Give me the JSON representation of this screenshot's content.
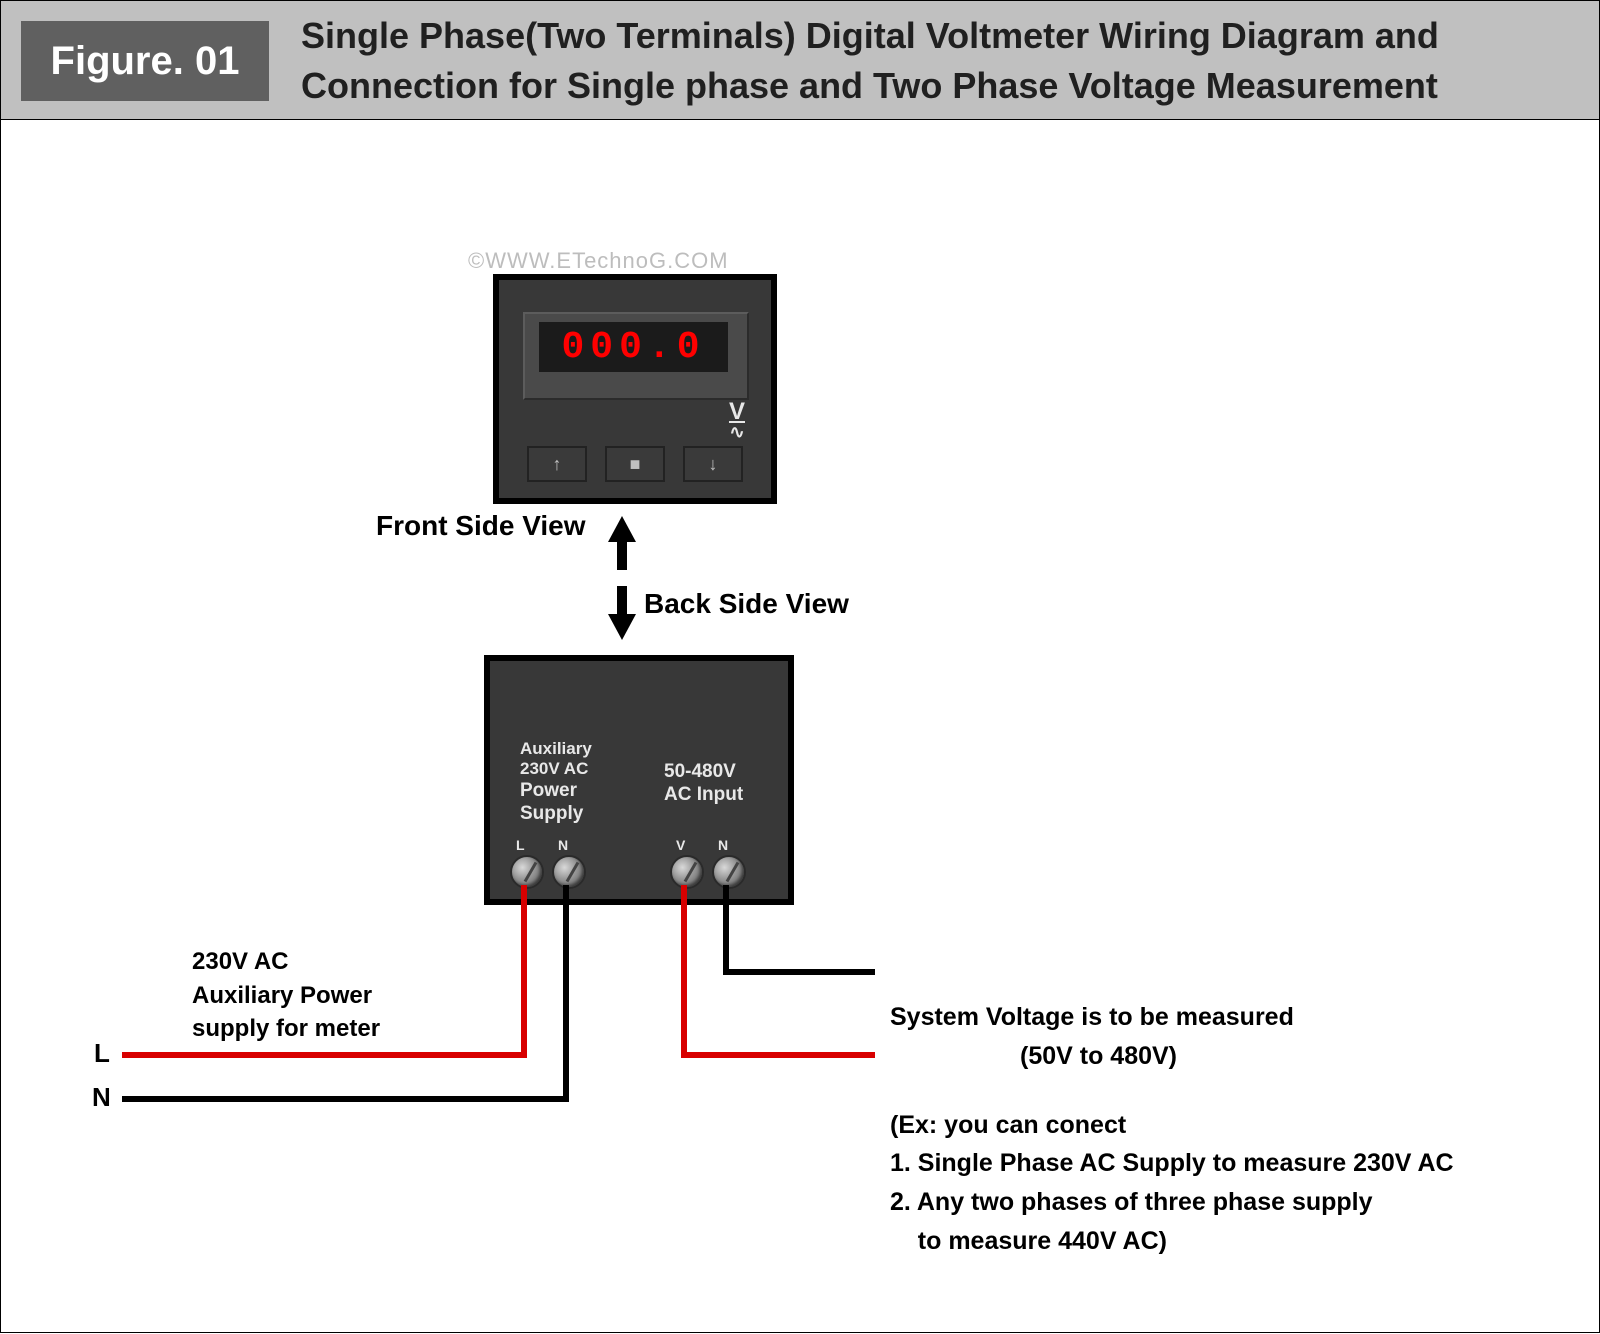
{
  "header": {
    "figure_label": "Figure. 01",
    "title": "Single Phase(Two Terminals) Digital Voltmeter Wiring Diagram and Connection for Single phase and Two Phase Voltage Measurement"
  },
  "watermark": "©WWW.ETechnoG.COM",
  "front_meter": {
    "reading": "000.0",
    "unit_symbol": "V",
    "ac_symbol": "∿",
    "buttons": {
      "up": "↑",
      "stop": "■",
      "down": "↓"
    }
  },
  "view_labels": {
    "front": "Front Side View",
    "back": "Back Side View"
  },
  "back_meter": {
    "aux_caption_line1": "Auxiliary",
    "aux_caption_line2": "230V AC",
    "aux_caption_line3": "Power",
    "aux_caption_line4": "Supply",
    "input_caption_line1": "50-480V",
    "input_caption_line2": "AC Input",
    "terminal_letters": {
      "aux_L": "L",
      "aux_N": "N",
      "in_V": "V",
      "in_N": "N"
    }
  },
  "wires": {
    "left_L_letter": "L",
    "left_N_letter": "N"
  },
  "left_block": {
    "line1": "230V AC",
    "line2": "Auxiliary Power",
    "line3": "supply for meter"
  },
  "right_block": {
    "heading": "System Voltage is to be measured",
    "range": "(50V to 480V)",
    "ex_intro": "(Ex: you can conect",
    "ex1": "1. Single Phase AC Supply to measure 230V AC",
    "ex2": "2. Any two phases of three phase supply",
    "ex2b": "    to measure 440V AC)"
  }
}
